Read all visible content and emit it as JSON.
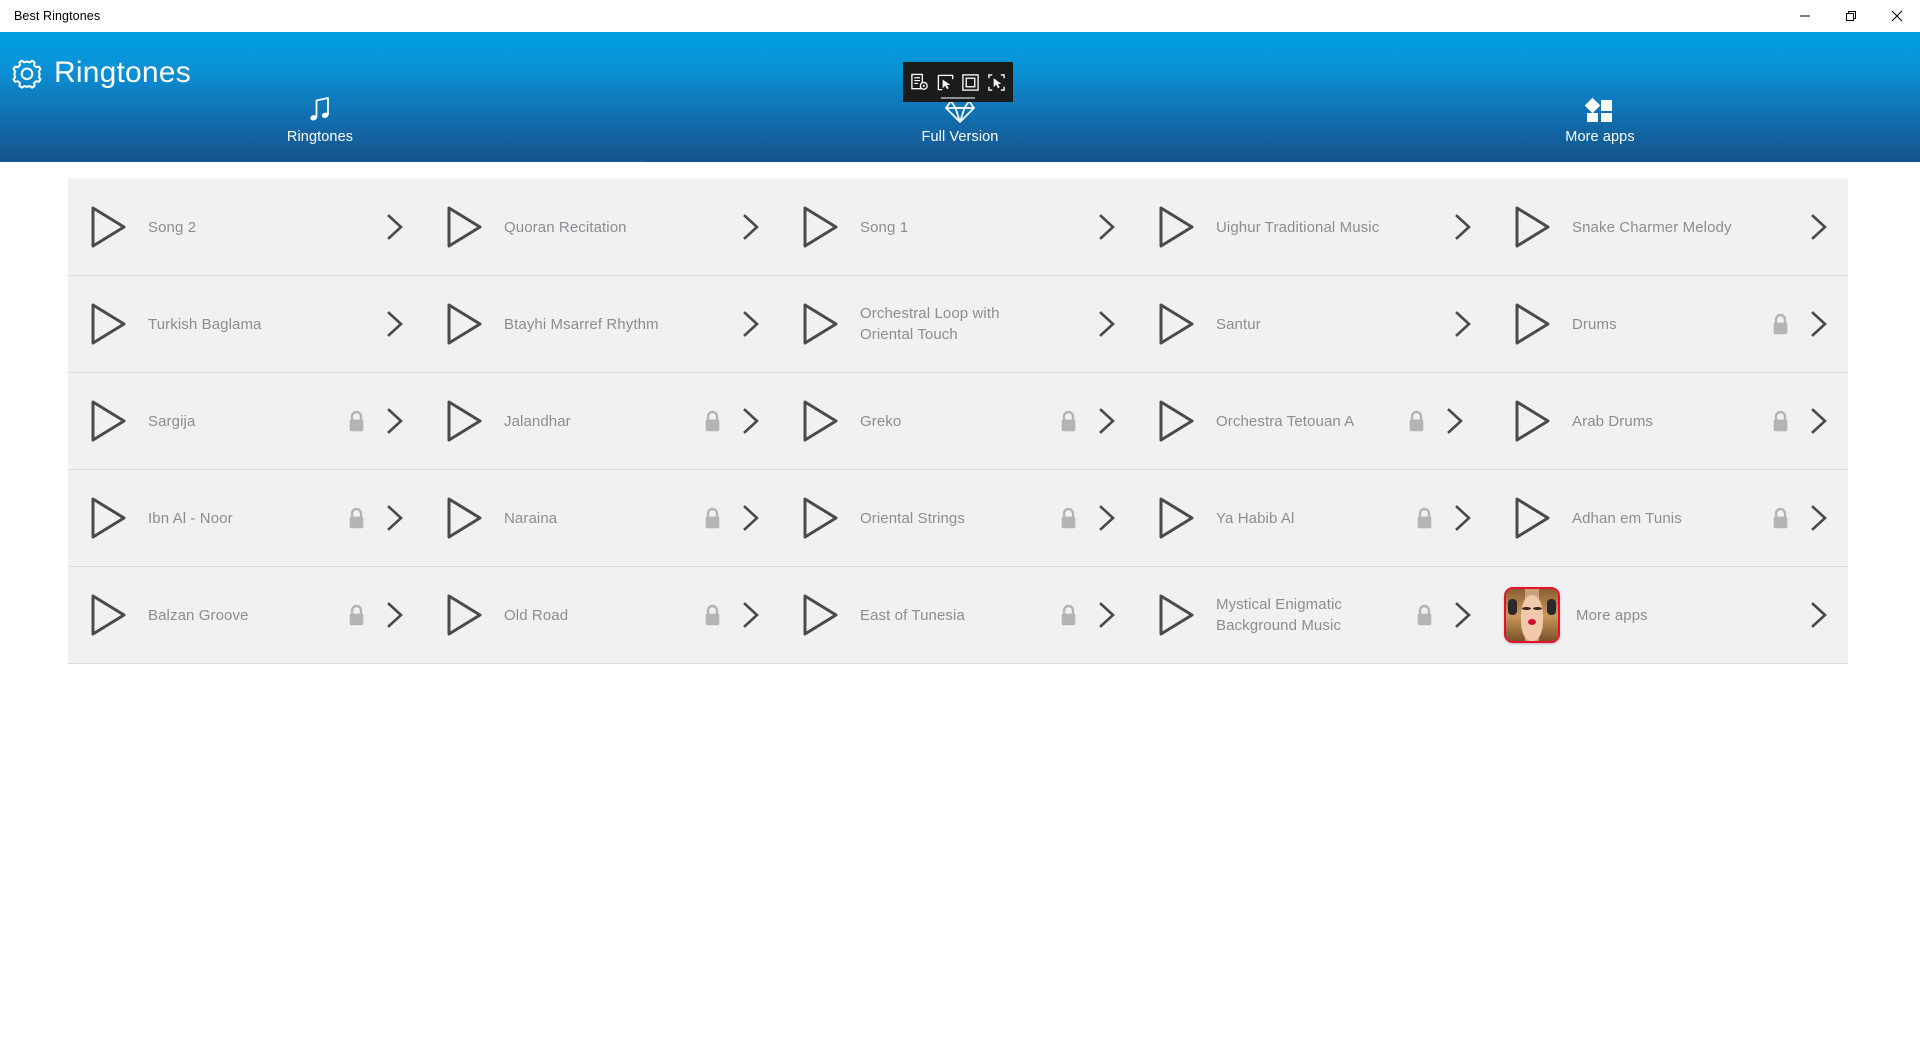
{
  "window": {
    "title": "Best Ringtones",
    "controls": [
      {
        "name": "minimize",
        "glyph": "minimize-icon"
      },
      {
        "name": "restore",
        "glyph": "restore-icon"
      },
      {
        "name": "close",
        "glyph": "close-icon"
      }
    ]
  },
  "capture_toolbar": {
    "buttons": [
      {
        "name": "capture-settings-icon",
        "label": "Capture settings"
      },
      {
        "name": "cursor-select-icon",
        "label": "Select cursor"
      },
      {
        "name": "capture-region-icon",
        "label": "Capture region"
      },
      {
        "name": "capture-window-icon",
        "label": "Capture window"
      }
    ]
  },
  "header": {
    "brand_icon": "gear-icon",
    "brand_title": "Ringtones",
    "accent_blue": "#00a1e4",
    "accent_dark_blue": "#16538c",
    "indicator_color": "#1f5f9c"
  },
  "tabs": [
    {
      "id": "ringtones",
      "label": "Ringtones",
      "icon": "music-note-icon",
      "active": true
    },
    {
      "id": "full-version",
      "label": "Full Version",
      "icon": "diamond-icon",
      "active": false
    },
    {
      "id": "more-apps",
      "label": "More apps",
      "icon": "apps-grid-icon",
      "active": false
    }
  ],
  "list": {
    "columns": 5,
    "items": [
      {
        "label": "Song 2",
        "locked": false,
        "type": "ringtone"
      },
      {
        "label": "Quoran Recitation",
        "locked": false,
        "type": "ringtone"
      },
      {
        "label": "Song 1",
        "locked": false,
        "type": "ringtone"
      },
      {
        "label": "Uighur Traditional Music",
        "locked": false,
        "type": "ringtone"
      },
      {
        "label": "Snake Charmer Melody",
        "locked": false,
        "type": "ringtone"
      },
      {
        "label": "Turkish Baglama",
        "locked": false,
        "type": "ringtone"
      },
      {
        "label": "Btayhi Msarref Rhythm",
        "locked": false,
        "type": "ringtone"
      },
      {
        "label": "Orchestral Loop with\nOriental Touch",
        "locked": false,
        "type": "ringtone"
      },
      {
        "label": "Santur",
        "locked": false,
        "type": "ringtone"
      },
      {
        "label": "Drums",
        "locked": true,
        "type": "ringtone"
      },
      {
        "label": "Sargija",
        "locked": true,
        "type": "ringtone"
      },
      {
        "label": "Jalandhar",
        "locked": true,
        "type": "ringtone"
      },
      {
        "label": "Greko",
        "locked": true,
        "type": "ringtone"
      },
      {
        "label": "Orchestra Tetouan A",
        "locked": true,
        "type": "ringtone",
        "truncated": true
      },
      {
        "label": "Arab Drums",
        "locked": true,
        "type": "ringtone"
      },
      {
        "label": "Ibn Al - Noor",
        "locked": true,
        "type": "ringtone"
      },
      {
        "label": "Naraina",
        "locked": true,
        "type": "ringtone"
      },
      {
        "label": "Oriental Strings",
        "locked": true,
        "type": "ringtone"
      },
      {
        "label": "Ya Habib Al",
        "locked": true,
        "type": "ringtone"
      },
      {
        "label": "Adhan em Tunis",
        "locked": true,
        "type": "ringtone"
      },
      {
        "label": "Balzan Groove",
        "locked": true,
        "type": "ringtone"
      },
      {
        "label": "Old Road",
        "locked": true,
        "type": "ringtone"
      },
      {
        "label": "East of Tunesia",
        "locked": true,
        "type": "ringtone"
      },
      {
        "label": "Mystical Enigmatic\nBackground Music",
        "locked": true,
        "type": "ringtone"
      },
      {
        "label": "More apps",
        "locked": false,
        "type": "promo"
      }
    ]
  },
  "colors": {
    "row_bg": "#f0f1f2",
    "row_divider": "#dcdddf",
    "label_text": "#8b8d8f",
    "icon_stroke": "#4a4a4a",
    "lock_fill": "#b4b4b4",
    "page_bg": "#ffffff"
  }
}
